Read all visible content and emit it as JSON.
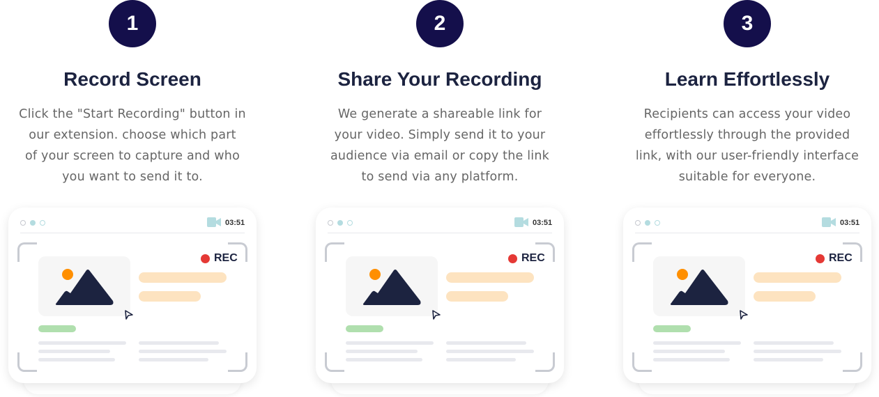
{
  "steps": [
    {
      "number": "1",
      "title": "Record Screen",
      "lines": [
        "Click the \"Start Recording\" button in",
        "our extension.  choose which part",
        "of your screen to capture and who",
        "you want to send it to."
      ]
    },
    {
      "number": "2",
      "title": "Share Your Recording",
      "lines": [
        "We generate a shareable link for",
        "your video. Simply send it to your",
        "audience via email or copy the link",
        "to send via any platform."
      ]
    },
    {
      "number": "3",
      "title": "Learn Effortlessly",
      "lines": [
        "Recipients can access your video",
        "effortlessly through the provided",
        "link, with our user-friendly interface",
        "suitable for everyone."
      ]
    }
  ],
  "mockup": {
    "time": "03:51",
    "rec_label": "REC",
    "icon": "video-camera-icon"
  },
  "colors": {
    "badge": "#140f4b",
    "rec": "#e53935",
    "orange": "#ff8f00",
    "accent_bar": "#fde3c0",
    "green_bar": "#b0dfae",
    "mountain": "#1c2340"
  }
}
